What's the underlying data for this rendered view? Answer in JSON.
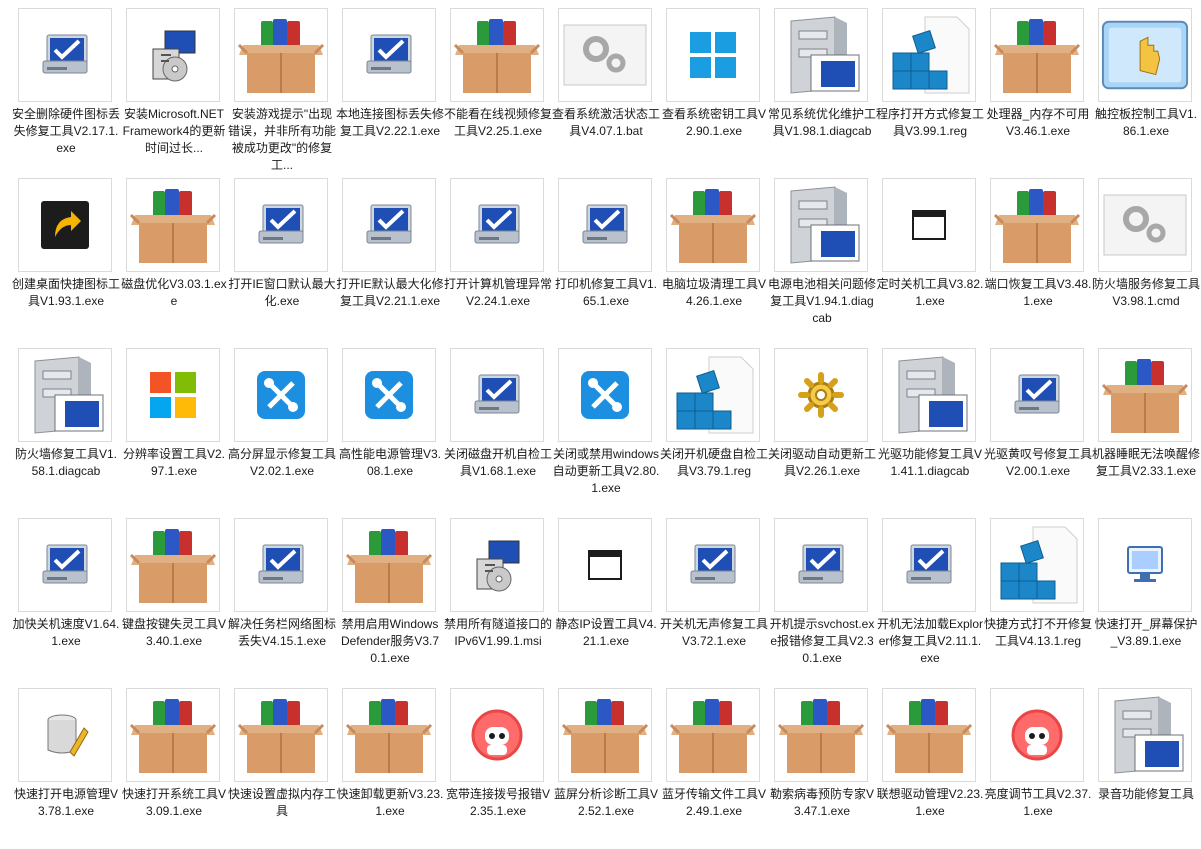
{
  "files": [
    {
      "name": "安全删除硬件图标丢失修复工具V2.17.1.exe",
      "icon": "monitor-check-icon"
    },
    {
      "name": "安装Microsoft.NET Framework4的更新时间过长...",
      "icon": "installer-icon"
    },
    {
      "name": "安装游戏提示\"出现错误，并非所有功能被成功更改\"的修复工...",
      "icon": "archive-box-icon"
    },
    {
      "name": "本地连接图标丢失修复工具V2.22.1.exe",
      "icon": "monitor-check-icon"
    },
    {
      "name": "不能看在线视频修复工具V2.25.1.exe",
      "icon": "archive-box-icon"
    },
    {
      "name": "查看系统激活状态工具V4.07.1.bat",
      "icon": "gear-file-icon"
    },
    {
      "name": "查看系统密钥工具V2.90.1.exe",
      "icon": "windows-logo-icon"
    },
    {
      "name": "常见系统优化维护工具V1.98.1.diagcab",
      "icon": "cabinet-icon"
    },
    {
      "name": "程序打开方式修复工具V3.99.1.reg",
      "icon": "registry-icon"
    },
    {
      "name": "处理器_内存不可用V3.46.1.exe",
      "icon": "archive-box-icon"
    },
    {
      "name": "触控板控制工具V1.86.1.exe",
      "icon": "touchpad-hand-icon"
    },
    {
      "name": "创建桌面快捷图标工具V1.93.1.exe",
      "icon": "shortcut-arrow-icon"
    },
    {
      "name": "磁盘优化V3.03.1.exe",
      "icon": "archive-box-icon"
    },
    {
      "name": "打开IE窗口默认最大化.exe",
      "icon": "monitor-check-icon"
    },
    {
      "name": "打开IE默认最大化修复工具V2.21.1.exe",
      "icon": "monitor-check-icon"
    },
    {
      "name": "打开计算机管理异常V2.24.1.exe",
      "icon": "monitor-check-icon"
    },
    {
      "name": "打印机修复工具V1.65.1.exe",
      "icon": "monitor-check-icon"
    },
    {
      "name": "电脑垃圾清理工具V4.26.1.exe",
      "icon": "archive-box-icon"
    },
    {
      "name": "电源电池相关问题修复工具V1.94.1.diagcab",
      "icon": "cabinet-icon"
    },
    {
      "name": "定时关机工具V3.82.1.exe",
      "icon": "window-app-icon"
    },
    {
      "name": "端口恢复工具V3.48.1.exe",
      "icon": "archive-box-icon"
    },
    {
      "name": "防火墙服务修复工具V3.98.1.cmd",
      "icon": "gear-file-icon"
    },
    {
      "name": "防火墙修复工具V1.58.1.diagcab",
      "icon": "cabinet-icon"
    },
    {
      "name": "分辨率设置工具V2.97.1.exe",
      "icon": "ms-logo-icon"
    },
    {
      "name": "高分屏显示修复工具V2.02.1.exe",
      "icon": "wrench-screwdriver-icon"
    },
    {
      "name": "高性能电源管理V3.08.1.exe",
      "icon": "wrench-screwdriver-icon"
    },
    {
      "name": "关闭磁盘开机自检工具V1.68.1.exe",
      "icon": "monitor-check-icon"
    },
    {
      "name": "关闭或禁用windows自动更新工具V2.80.1.exe",
      "icon": "wrench-screwdriver-icon"
    },
    {
      "name": "关闭开机硬盘自检工具V3.79.1.reg",
      "icon": "registry-icon"
    },
    {
      "name": "关闭驱动自动更新工具V2.26.1.exe",
      "icon": "gear-yellow-icon"
    },
    {
      "name": "光驱功能修复工具V1.41.1.diagcab",
      "icon": "cabinet-icon"
    },
    {
      "name": "光驱黄叹号修复工具V2.00.1.exe",
      "icon": "monitor-check-icon"
    },
    {
      "name": "机器睡眠无法唤醒修复工具V2.33.1.exe",
      "icon": "archive-box-icon"
    },
    {
      "name": "加快关机速度V1.64.1.exe",
      "icon": "monitor-check-icon"
    },
    {
      "name": "键盘按键失灵工具V3.40.1.exe",
      "icon": "archive-box-icon"
    },
    {
      "name": "解决任务栏网络图标丢失V4.15.1.exe",
      "icon": "monitor-check-icon"
    },
    {
      "name": "禁用启用Windows Defender服务V3.70.1.exe",
      "icon": "archive-box-icon"
    },
    {
      "name": "禁用所有隧道接口的IPv6V1.99.1.msi",
      "icon": "installer-icon"
    },
    {
      "name": "静态IP设置工具V4.21.1.exe",
      "icon": "window-app-icon"
    },
    {
      "name": "开关机无声修复工具V3.72.1.exe",
      "icon": "monitor-check-icon"
    },
    {
      "name": "开机提示svchost.exe报错修复工具V2.30.1.exe",
      "icon": "monitor-check-icon"
    },
    {
      "name": "开机无法加载Explorer修复工具V2.11.1.exe",
      "icon": "monitor-check-icon"
    },
    {
      "name": "快捷方式打不开修复工具V4.13.1.reg",
      "icon": "registry-icon"
    },
    {
      "name": "快速打开_屏幕保护_V3.89.1.exe",
      "icon": "monitor-small-icon"
    },
    {
      "name": "快速打开电源管理V3.78.1.exe",
      "icon": "db-pencil-icon"
    },
    {
      "name": "快速打开系统工具V3.09.1.exe",
      "icon": "archive-box-icon"
    },
    {
      "name": "快速设置虚拟内存工具",
      "icon": "archive-box-icon"
    },
    {
      "name": "快速卸载更新V3.23.1.exe",
      "icon": "archive-box-icon"
    },
    {
      "name": "宽带连接拨号报错V2.35.1.exe",
      "icon": "robot-icon"
    },
    {
      "name": "蓝屏分析诊断工具V2.52.1.exe",
      "icon": "archive-box-icon"
    },
    {
      "name": "蓝牙传输文件工具V2.49.1.exe",
      "icon": "archive-box-icon"
    },
    {
      "name": "勒索病毒预防专家V3.47.1.exe",
      "icon": "archive-box-icon"
    },
    {
      "name": "联想驱动管理V2.23.1.exe",
      "icon": "archive-box-icon"
    },
    {
      "name": "亮度调节工具V2.37.1.exe",
      "icon": "robot-icon"
    },
    {
      "name": "录音功能修复工具",
      "icon": "cabinet-icon"
    }
  ]
}
